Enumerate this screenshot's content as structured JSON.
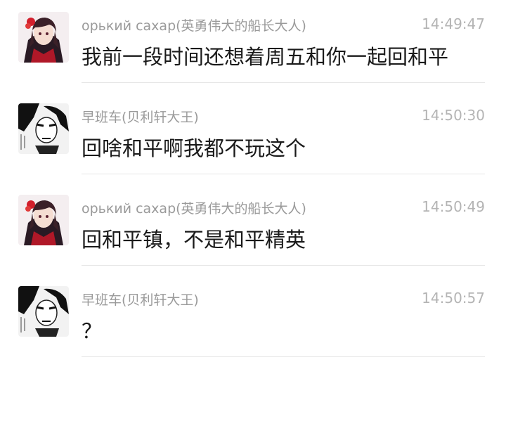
{
  "messages": [
    {
      "sender": "орький сахар(英勇伟大的船长大人)",
      "time": "14:49:47",
      "text": "我前一段时间还想着周五和你一起回和平",
      "avatar": "anime-girl-avatar"
    },
    {
      "sender": "早班车(贝利轩大王)",
      "time": "14:50:30",
      "text": "回啥和平啊我都不玩这个",
      "avatar": "manga-man-avatar"
    },
    {
      "sender": "орький сахар(英勇伟大的船长大人)",
      "time": "14:50:49",
      "text": "回和平镇，不是和平精英",
      "avatar": "anime-girl-avatar"
    },
    {
      "sender": "早班车(贝利轩大王)",
      "time": "14:50:57",
      "text": "？",
      "avatar": "manga-man-avatar"
    }
  ],
  "colors": {
    "sender": "#9a9a9a",
    "time": "#b4b4b4",
    "text": "#1a1a1a",
    "divider": "#e6e6e6"
  }
}
